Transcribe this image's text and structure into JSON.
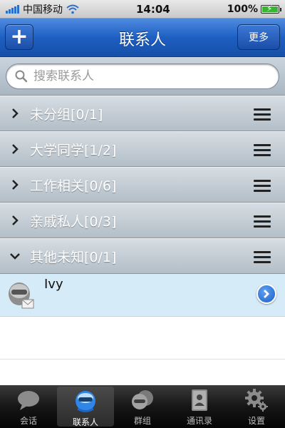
{
  "status_bar": {
    "carrier": "中国移动",
    "time": "14:04",
    "battery": "100%"
  },
  "nav": {
    "title": "联系人",
    "add_label": "+",
    "more_label": "更多"
  },
  "search": {
    "placeholder": "搜索联系人"
  },
  "groups": [
    {
      "label": "未分组[0/1]",
      "expanded": false
    },
    {
      "label": "大学同学[1/2]",
      "expanded": false
    },
    {
      "label": "工作相关[0/6]",
      "expanded": false
    },
    {
      "label": "亲戚私人[0/3]",
      "expanded": false
    },
    {
      "label": "其他未知[0/1]",
      "expanded": true
    }
  ],
  "contacts": [
    {
      "name": "Ivy",
      "group": "其他未知"
    }
  ],
  "tabs": [
    {
      "label": "会话",
      "icon": "chat-bubble-icon",
      "active": false
    },
    {
      "label": "联系人",
      "icon": "contacts-icon",
      "active": true
    },
    {
      "label": "群组",
      "icon": "group-icon",
      "active": false
    },
    {
      "label": "通讯录",
      "icon": "address-book-icon",
      "active": false
    },
    {
      "label": "设置",
      "icon": "gear-icon",
      "active": false
    }
  ],
  "colors": {
    "nav_blue": "#1e5fc2",
    "contact_highlight": "#d6ebf8",
    "tab_bar": "#111111"
  }
}
